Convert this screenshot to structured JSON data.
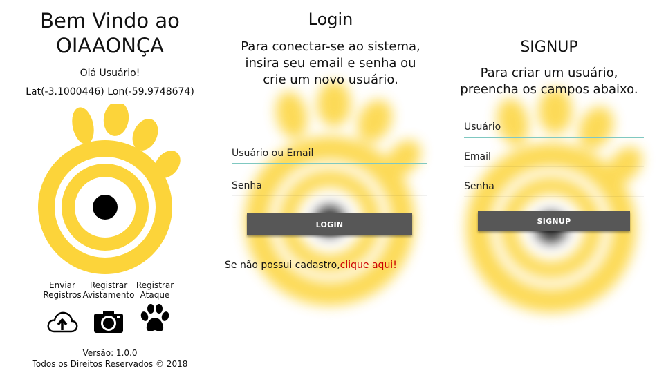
{
  "home": {
    "title_line1": "Bem Vindo ao",
    "title_line2": "OIAAONÇA",
    "greeting": "Olá Usuário!",
    "coords": "Lat(-3.1000446) Lon(-59.9748674)",
    "actions": [
      {
        "line1": "Enviar",
        "line2": "Registros",
        "icon": "cloud-upload-icon"
      },
      {
        "line1": "Registrar",
        "line2": "Avistamento",
        "icon": "camera-icon"
      },
      {
        "line1": "Registrar",
        "line2": "Ataque",
        "icon": "paw-icon"
      }
    ],
    "version": "Versão: 1.0.0",
    "rights": "Todos os Direitos Reservados © 2018"
  },
  "login": {
    "title": "Login",
    "sub_line1": "Para conectar-se ao sistema,",
    "sub_line2": "insira seu email e senha ou",
    "sub_line3": "crie um novo usuário.",
    "user_placeholder": "Usuário ou Email",
    "password_placeholder": "Senha",
    "button": "LOGIN",
    "register_text": "Se não possui cadastro,",
    "register_link": "clique aqui!"
  },
  "signup": {
    "title": "SIGNUP",
    "sub_line1": "Para criar um usuário,",
    "sub_line2": "preencha os campos abaixo.",
    "user_placeholder": "Usuário",
    "email_placeholder": "Email",
    "password_placeholder": "Senha",
    "button": "SIGNUP"
  },
  "colors": {
    "brand_yellow": "#fcd43a",
    "button_gray": "#575757",
    "link_red": "#cc0000",
    "input_accent": "#7fc8c1"
  }
}
